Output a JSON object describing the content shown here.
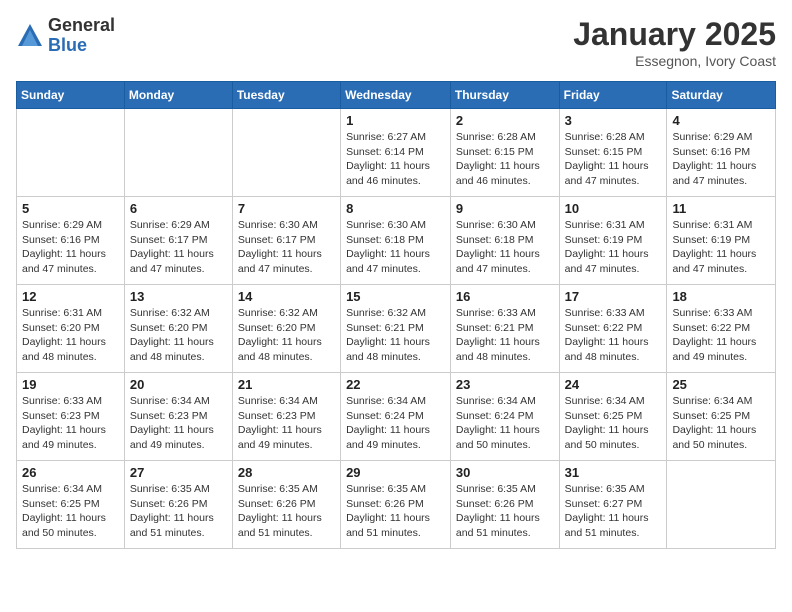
{
  "logo": {
    "general": "General",
    "blue": "Blue"
  },
  "header": {
    "month": "January 2025",
    "location": "Essegnon, Ivory Coast"
  },
  "weekdays": [
    "Sunday",
    "Monday",
    "Tuesday",
    "Wednesday",
    "Thursday",
    "Friday",
    "Saturday"
  ],
  "weeks": [
    [
      {
        "day": "",
        "sunrise": "",
        "sunset": "",
        "daylight": "",
        "empty": true
      },
      {
        "day": "",
        "sunrise": "",
        "sunset": "",
        "daylight": "",
        "empty": true
      },
      {
        "day": "",
        "sunrise": "",
        "sunset": "",
        "daylight": "",
        "empty": true
      },
      {
        "day": "1",
        "sunrise": "Sunrise: 6:27 AM",
        "sunset": "Sunset: 6:14 PM",
        "daylight": "Daylight: 11 hours and 46 minutes."
      },
      {
        "day": "2",
        "sunrise": "Sunrise: 6:28 AM",
        "sunset": "Sunset: 6:15 PM",
        "daylight": "Daylight: 11 hours and 46 minutes."
      },
      {
        "day": "3",
        "sunrise": "Sunrise: 6:28 AM",
        "sunset": "Sunset: 6:15 PM",
        "daylight": "Daylight: 11 hours and 47 minutes."
      },
      {
        "day": "4",
        "sunrise": "Sunrise: 6:29 AM",
        "sunset": "Sunset: 6:16 PM",
        "daylight": "Daylight: 11 hours and 47 minutes."
      }
    ],
    [
      {
        "day": "5",
        "sunrise": "Sunrise: 6:29 AM",
        "sunset": "Sunset: 6:16 PM",
        "daylight": "Daylight: 11 hours and 47 minutes."
      },
      {
        "day": "6",
        "sunrise": "Sunrise: 6:29 AM",
        "sunset": "Sunset: 6:17 PM",
        "daylight": "Daylight: 11 hours and 47 minutes."
      },
      {
        "day": "7",
        "sunrise": "Sunrise: 6:30 AM",
        "sunset": "Sunset: 6:17 PM",
        "daylight": "Daylight: 11 hours and 47 minutes."
      },
      {
        "day": "8",
        "sunrise": "Sunrise: 6:30 AM",
        "sunset": "Sunset: 6:18 PM",
        "daylight": "Daylight: 11 hours and 47 minutes."
      },
      {
        "day": "9",
        "sunrise": "Sunrise: 6:30 AM",
        "sunset": "Sunset: 6:18 PM",
        "daylight": "Daylight: 11 hours and 47 minutes."
      },
      {
        "day": "10",
        "sunrise": "Sunrise: 6:31 AM",
        "sunset": "Sunset: 6:19 PM",
        "daylight": "Daylight: 11 hours and 47 minutes."
      },
      {
        "day": "11",
        "sunrise": "Sunrise: 6:31 AM",
        "sunset": "Sunset: 6:19 PM",
        "daylight": "Daylight: 11 hours and 47 minutes."
      }
    ],
    [
      {
        "day": "12",
        "sunrise": "Sunrise: 6:31 AM",
        "sunset": "Sunset: 6:20 PM",
        "daylight": "Daylight: 11 hours and 48 minutes."
      },
      {
        "day": "13",
        "sunrise": "Sunrise: 6:32 AM",
        "sunset": "Sunset: 6:20 PM",
        "daylight": "Daylight: 11 hours and 48 minutes."
      },
      {
        "day": "14",
        "sunrise": "Sunrise: 6:32 AM",
        "sunset": "Sunset: 6:20 PM",
        "daylight": "Daylight: 11 hours and 48 minutes."
      },
      {
        "day": "15",
        "sunrise": "Sunrise: 6:32 AM",
        "sunset": "Sunset: 6:21 PM",
        "daylight": "Daylight: 11 hours and 48 minutes."
      },
      {
        "day": "16",
        "sunrise": "Sunrise: 6:33 AM",
        "sunset": "Sunset: 6:21 PM",
        "daylight": "Daylight: 11 hours and 48 minutes."
      },
      {
        "day": "17",
        "sunrise": "Sunrise: 6:33 AM",
        "sunset": "Sunset: 6:22 PM",
        "daylight": "Daylight: 11 hours and 48 minutes."
      },
      {
        "day": "18",
        "sunrise": "Sunrise: 6:33 AM",
        "sunset": "Sunset: 6:22 PM",
        "daylight": "Daylight: 11 hours and 49 minutes."
      }
    ],
    [
      {
        "day": "19",
        "sunrise": "Sunrise: 6:33 AM",
        "sunset": "Sunset: 6:23 PM",
        "daylight": "Daylight: 11 hours and 49 minutes."
      },
      {
        "day": "20",
        "sunrise": "Sunrise: 6:34 AM",
        "sunset": "Sunset: 6:23 PM",
        "daylight": "Daylight: 11 hours and 49 minutes."
      },
      {
        "day": "21",
        "sunrise": "Sunrise: 6:34 AM",
        "sunset": "Sunset: 6:23 PM",
        "daylight": "Daylight: 11 hours and 49 minutes."
      },
      {
        "day": "22",
        "sunrise": "Sunrise: 6:34 AM",
        "sunset": "Sunset: 6:24 PM",
        "daylight": "Daylight: 11 hours and 49 minutes."
      },
      {
        "day": "23",
        "sunrise": "Sunrise: 6:34 AM",
        "sunset": "Sunset: 6:24 PM",
        "daylight": "Daylight: 11 hours and 50 minutes."
      },
      {
        "day": "24",
        "sunrise": "Sunrise: 6:34 AM",
        "sunset": "Sunset: 6:25 PM",
        "daylight": "Daylight: 11 hours and 50 minutes."
      },
      {
        "day": "25",
        "sunrise": "Sunrise: 6:34 AM",
        "sunset": "Sunset: 6:25 PM",
        "daylight": "Daylight: 11 hours and 50 minutes."
      }
    ],
    [
      {
        "day": "26",
        "sunrise": "Sunrise: 6:34 AM",
        "sunset": "Sunset: 6:25 PM",
        "daylight": "Daylight: 11 hours and 50 minutes."
      },
      {
        "day": "27",
        "sunrise": "Sunrise: 6:35 AM",
        "sunset": "Sunset: 6:26 PM",
        "daylight": "Daylight: 11 hours and 51 minutes."
      },
      {
        "day": "28",
        "sunrise": "Sunrise: 6:35 AM",
        "sunset": "Sunset: 6:26 PM",
        "daylight": "Daylight: 11 hours and 51 minutes."
      },
      {
        "day": "29",
        "sunrise": "Sunrise: 6:35 AM",
        "sunset": "Sunset: 6:26 PM",
        "daylight": "Daylight: 11 hours and 51 minutes."
      },
      {
        "day": "30",
        "sunrise": "Sunrise: 6:35 AM",
        "sunset": "Sunset: 6:26 PM",
        "daylight": "Daylight: 11 hours and 51 minutes."
      },
      {
        "day": "31",
        "sunrise": "Sunrise: 6:35 AM",
        "sunset": "Sunset: 6:27 PM",
        "daylight": "Daylight: 11 hours and 51 minutes."
      },
      {
        "day": "",
        "sunrise": "",
        "sunset": "",
        "daylight": "",
        "empty": true
      }
    ]
  ]
}
